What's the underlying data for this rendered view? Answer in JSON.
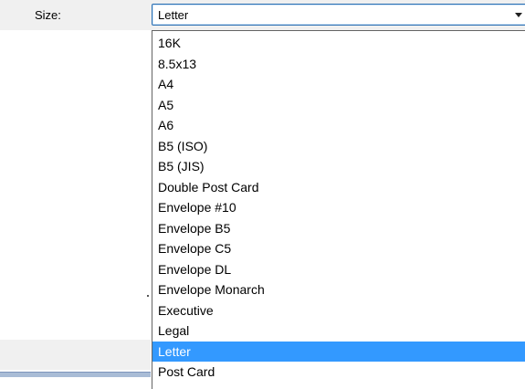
{
  "size_label": "Size:",
  "combo": {
    "value": "Letter"
  },
  "dropdown": {
    "options": [
      "16K",
      "8.5x13",
      "A4",
      "A5",
      "A6",
      "B5 (ISO)",
      "B5 (JIS)",
      "Double Post Card",
      "Envelope #10",
      "Envelope B5",
      "Envelope C5",
      "Envelope DL",
      "Envelope Monarch",
      "Executive",
      "Legal",
      "Letter",
      "Post Card"
    ],
    "selected_option": "Letter"
  },
  "colors": {
    "selection": "#3399ff",
    "combo_border": "#2a6fb2",
    "dialog_background": "#f0f0f0"
  }
}
